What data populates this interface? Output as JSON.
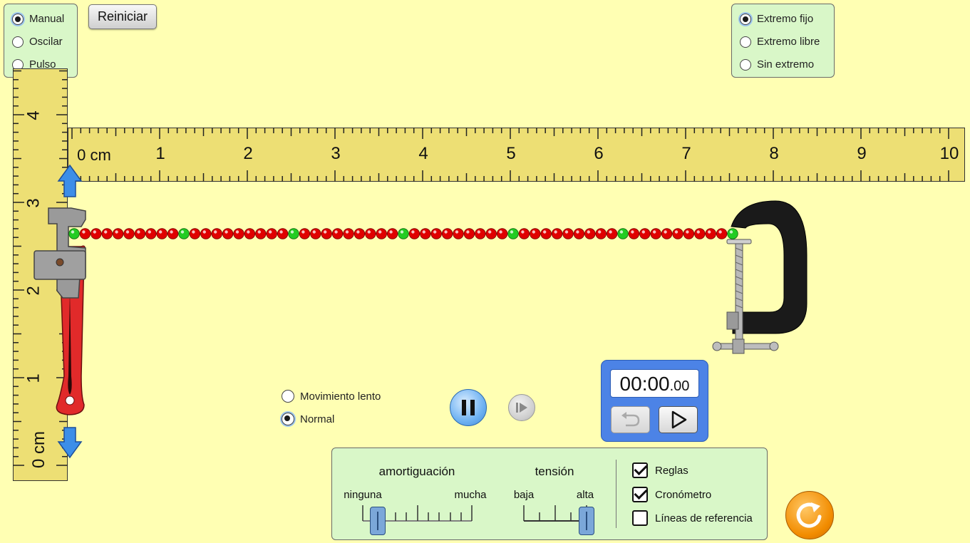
{
  "mode_panel": {
    "options": [
      {
        "label": "Manual",
        "selected": true
      },
      {
        "label": "Oscilar",
        "selected": false
      },
      {
        "label": "Pulso",
        "selected": false
      }
    ]
  },
  "reset_button": {
    "label": "Reiniciar"
  },
  "end_panel": {
    "options": [
      {
        "label": "Extremo fijo",
        "selected": true
      },
      {
        "label": "Extremo libre",
        "selected": false
      },
      {
        "label": "Sin extremo",
        "selected": false
      }
    ]
  },
  "horizontal_ruler": {
    "unit": "cm",
    "labels": [
      "0",
      "1",
      "2",
      "3",
      "4",
      "5",
      "6",
      "7",
      "8",
      "9",
      "10"
    ]
  },
  "vertical_ruler": {
    "unit": "cm",
    "labels": [
      "0",
      "1",
      "2",
      "3",
      "4"
    ]
  },
  "speed_panel": {
    "options": [
      {
        "label": "Movimiento lento",
        "selected": false
      },
      {
        "label": "Normal",
        "selected": true
      }
    ]
  },
  "playback": {
    "pause_icon": "pause-icon",
    "step_icon": "step-forward-icon",
    "step_enabled": false
  },
  "timer": {
    "main": "00:00",
    "fraction": ".00",
    "rewind_icon": "rewind-icon",
    "play_icon": "play-icon"
  },
  "controls": {
    "damping": {
      "title": "amortiguación",
      "min_label": "ninguna",
      "max_label": "mucha",
      "value_fraction": 0.14
    },
    "tension": {
      "title": "tensión",
      "min_label": "baja",
      "max_label": "alta",
      "value_fraction": 1.0
    },
    "checkboxes": [
      {
        "label": "Reglas",
        "checked": true
      },
      {
        "label": "Cronómetro",
        "checked": true
      },
      {
        "label": "Líneas de referencia",
        "checked": false
      }
    ]
  },
  "reset_all_icon": "reset-all-icon",
  "string": {
    "bead_count": 61,
    "green_every": 10,
    "colors": {
      "red": "#e00000",
      "green": "#22cc22"
    }
  },
  "colors": {
    "background": "#ffffb3",
    "panel": "#d9f7c8",
    "ruler": "#eddf74",
    "accent_blue": "#4c83e6",
    "orange": "#f28c00"
  }
}
